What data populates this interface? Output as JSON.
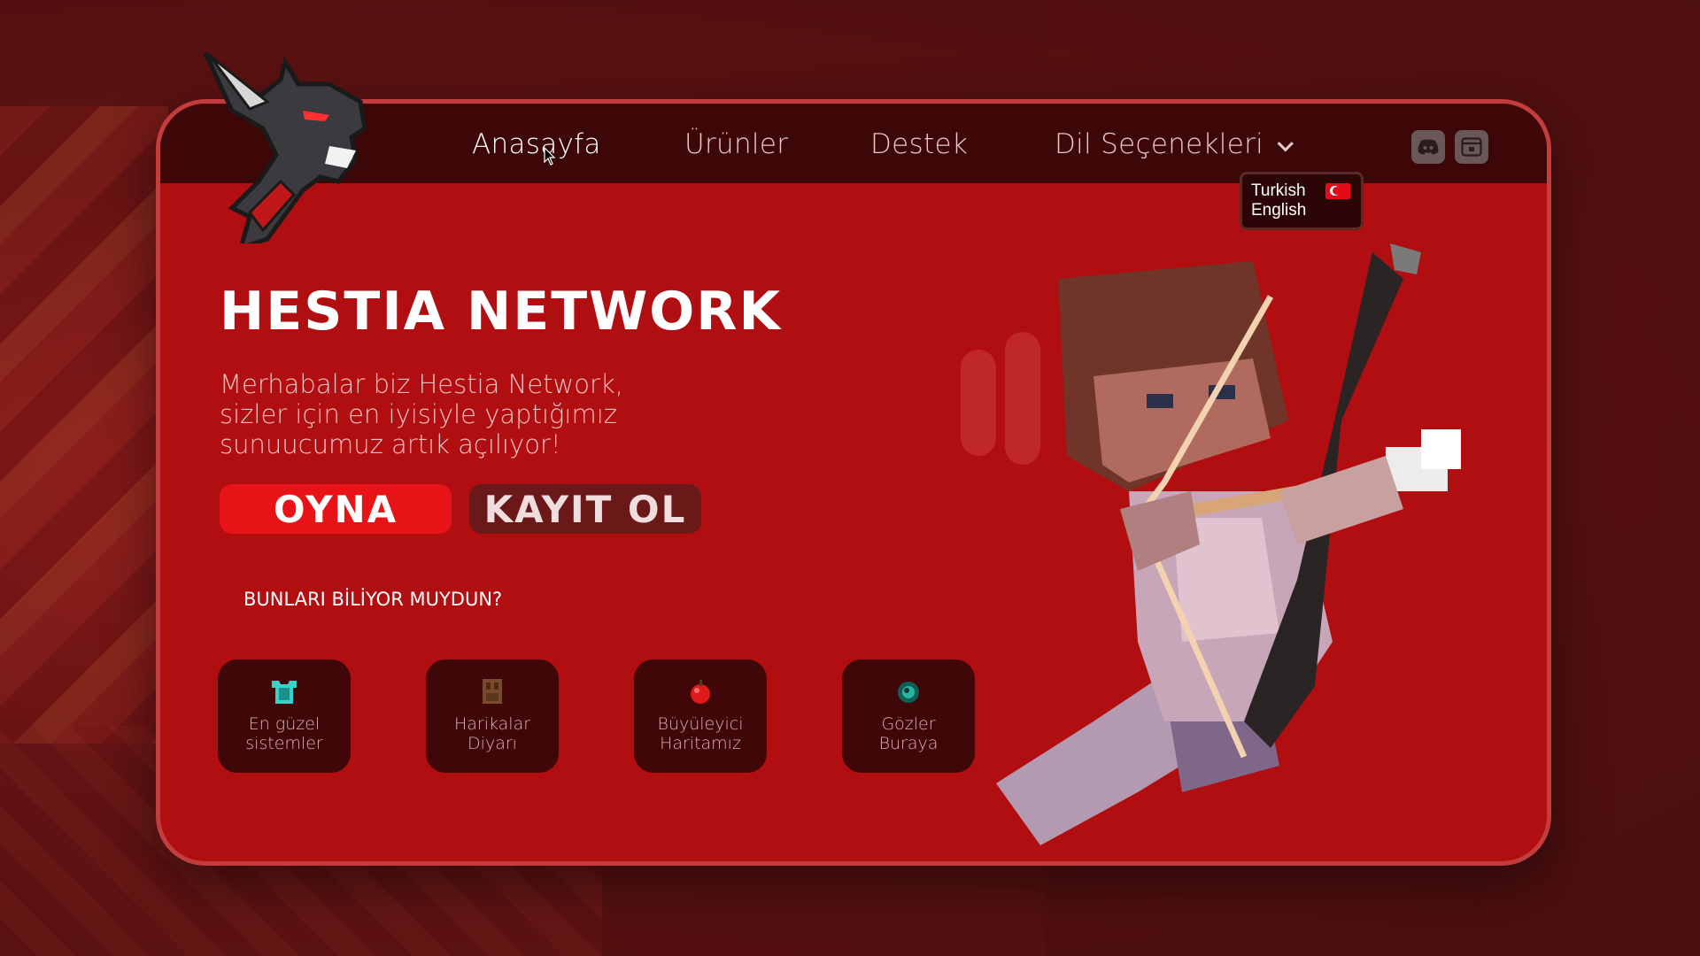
{
  "brand": {
    "logo_icon": "dragon-logo-icon"
  },
  "nav": {
    "items": [
      {
        "label": "Anasayfa",
        "active": true
      },
      {
        "label": "Ürünler",
        "active": false
      },
      {
        "label": "Destek",
        "active": false
      },
      {
        "label": "Dil Seçenekleri",
        "active": false
      }
    ],
    "icons": [
      "discord-icon",
      "browser-window-icon"
    ]
  },
  "language_dropdown": {
    "options": [
      {
        "label": "Turkish",
        "flag": "turkey-flag-icon"
      },
      {
        "label": "English"
      }
    ]
  },
  "hero": {
    "title": "HESTIA NETWORK",
    "subtitle_lines": [
      "Merhabalar biz Hestia Network,",
      "sizler için en iyisiyle yaptığımız",
      "sunuucumuz artık açılıyor!"
    ],
    "play_button": "OYNA",
    "register_button": "KAYIT OL"
  },
  "did_you_know": {
    "heading": "BUNLARI BİLİYOR MUYDUN?",
    "features": [
      {
        "icon": "diamond-chestplate-icon",
        "line1": "En güzel",
        "line2": "sistemler"
      },
      {
        "icon": "door-icon",
        "line1": "Harikalar",
        "line2": "Diyarı"
      },
      {
        "icon": "apple-icon",
        "line1": "Büyüleyici",
        "line2": "Haritamız"
      },
      {
        "icon": "ender-pearl-icon",
        "line1": "Gözler",
        "line2": "Buraya"
      }
    ]
  },
  "colors": {
    "page_bg": "#5e1212",
    "card_bg": "#b00e10",
    "navbar_bg": "#3d0708",
    "play_button": "#e81317",
    "register_button": "#6b1818",
    "feature_card": "#3f0708"
  }
}
